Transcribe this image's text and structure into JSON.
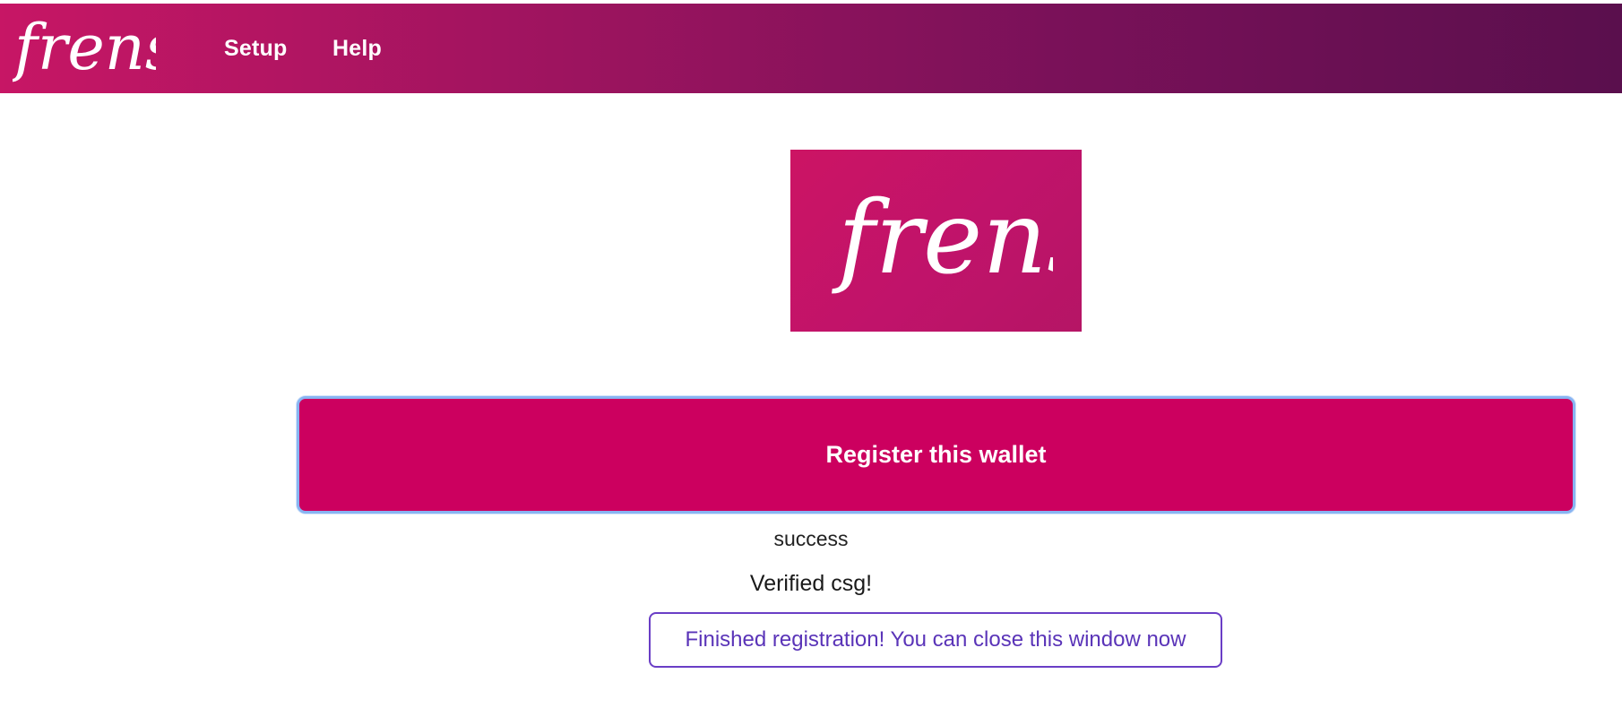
{
  "navbar": {
    "logo_text": "frens",
    "links": [
      {
        "label": "Setup"
      },
      {
        "label": "Help"
      }
    ]
  },
  "hero": {
    "logo_text": "frens"
  },
  "main": {
    "register_button_label": "Register this wallet",
    "status_text": "success",
    "verified_text": "Verified csg!",
    "finished_message": "Finished registration! You can close this window now"
  },
  "colors": {
    "brand_primary": "#cc005f",
    "navbar_gradient_start": "#c71665",
    "navbar_gradient_end": "#5a0f4d",
    "focus_border": "#88b4f2",
    "message_border": "#6a3ec6"
  }
}
